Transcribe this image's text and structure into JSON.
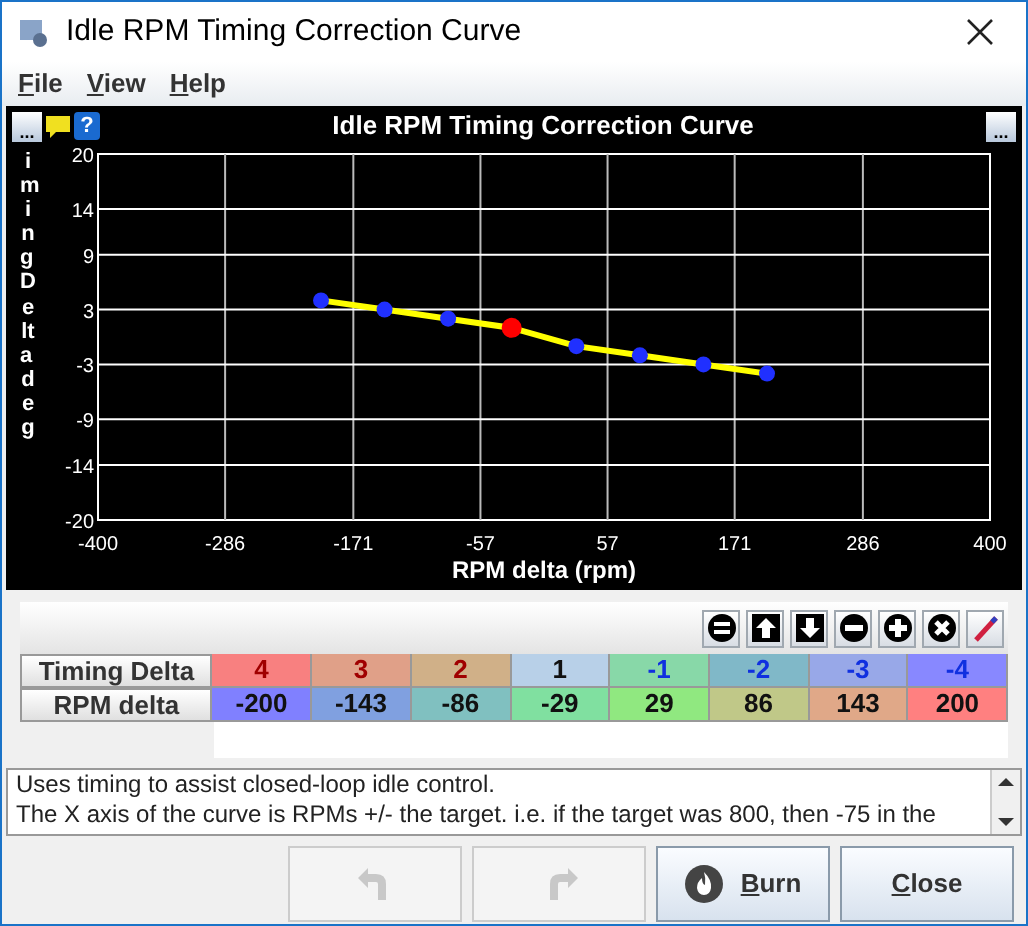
{
  "window": {
    "title": "Idle RPM Timing Correction Curve"
  },
  "menu": [
    {
      "label": "File"
    },
    {
      "label": "View"
    },
    {
      "label": "Help"
    }
  ],
  "chart_panel": {
    "title": "Idle RPM Timing Correction Curve",
    "left_button": "...",
    "right_button": "...",
    "help_glyph": "?",
    "y_axis_label": "iming Delta deg",
    "chart_data": {
      "type": "line",
      "xlabel": "RPM delta (rpm)",
      "x": [
        -200,
        -143,
        -86,
        -29,
        29,
        86,
        143,
        200
      ],
      "series": [
        {
          "color": "#ffff00",
          "marker": "circle",
          "values": [
            4,
            3,
            2,
            1,
            -1,
            -2,
            -3,
            -4
          ]
        }
      ],
      "grid": true,
      "xlim": [
        -400,
        400
      ],
      "ylim": [
        -20,
        20
      ],
      "xticks": [
        -400,
        -286,
        -171,
        -57,
        57,
        171,
        286,
        400
      ],
      "yticks": [
        -20,
        -14,
        -9,
        -3,
        3,
        9,
        14,
        20
      ]
    },
    "points": [
      {
        "selected": false
      },
      {
        "selected": false
      },
      {
        "selected": false
      },
      {
        "selected": true
      },
      {
        "selected": false
      },
      {
        "selected": false
      },
      {
        "selected": false
      },
      {
        "selected": false
      }
    ]
  },
  "table": {
    "rows": [
      {
        "label": "Timing Delta",
        "cells": [
          {
            "value": "4",
            "color": "#f88080",
            "kind": "positive"
          },
          {
            "value": "3",
            "color": "#e0a088",
            "kind": "positive"
          },
          {
            "value": "2",
            "color": "#d0b088",
            "kind": "positive"
          },
          {
            "value": "1",
            "color": "#b8d0e8",
            "kind": "neutral"
          },
          {
            "value": "-1",
            "color": "#88d8a8",
            "kind": "negative"
          },
          {
            "value": "-2",
            "color": "#80b8c8",
            "kind": "negative"
          },
          {
            "value": "-3",
            "color": "#98a8e8",
            "kind": "negative"
          },
          {
            "value": "-4",
            "color": "#8888ff",
            "kind": "negative"
          }
        ]
      },
      {
        "label": "RPM delta",
        "cells": [
          {
            "value": "-200",
            "color": "#8080ff",
            "kind": "neutral"
          },
          {
            "value": "-143",
            "color": "#80a0e0",
            "kind": "neutral"
          },
          {
            "value": "-86",
            "color": "#80c0c0",
            "kind": "neutral"
          },
          {
            "value": "-29",
            "color": "#80e0a0",
            "kind": "neutral"
          },
          {
            "value": "29",
            "color": "#90e880",
            "kind": "neutral"
          },
          {
            "value": "86",
            "color": "#c0c888",
            "kind": "neutral"
          },
          {
            "value": "143",
            "color": "#e0a888",
            "kind": "neutral"
          },
          {
            "value": "200",
            "color": "#ff8080",
            "kind": "neutral"
          }
        ]
      }
    ]
  },
  "description": [
    "Uses timing to assist closed-loop idle control.",
    "The X axis of the curve is RPMs +/- the target. i.e. if the target was 800, then -75 in the"
  ],
  "buttons": [
    {
      "kind": "undo",
      "disabled": true
    },
    {
      "kind": "redo",
      "disabled": true
    },
    {
      "kind": "burn",
      "label": "Burn",
      "disabled": false
    },
    {
      "kind": "close",
      "label": "Close",
      "disabled": false
    }
  ]
}
